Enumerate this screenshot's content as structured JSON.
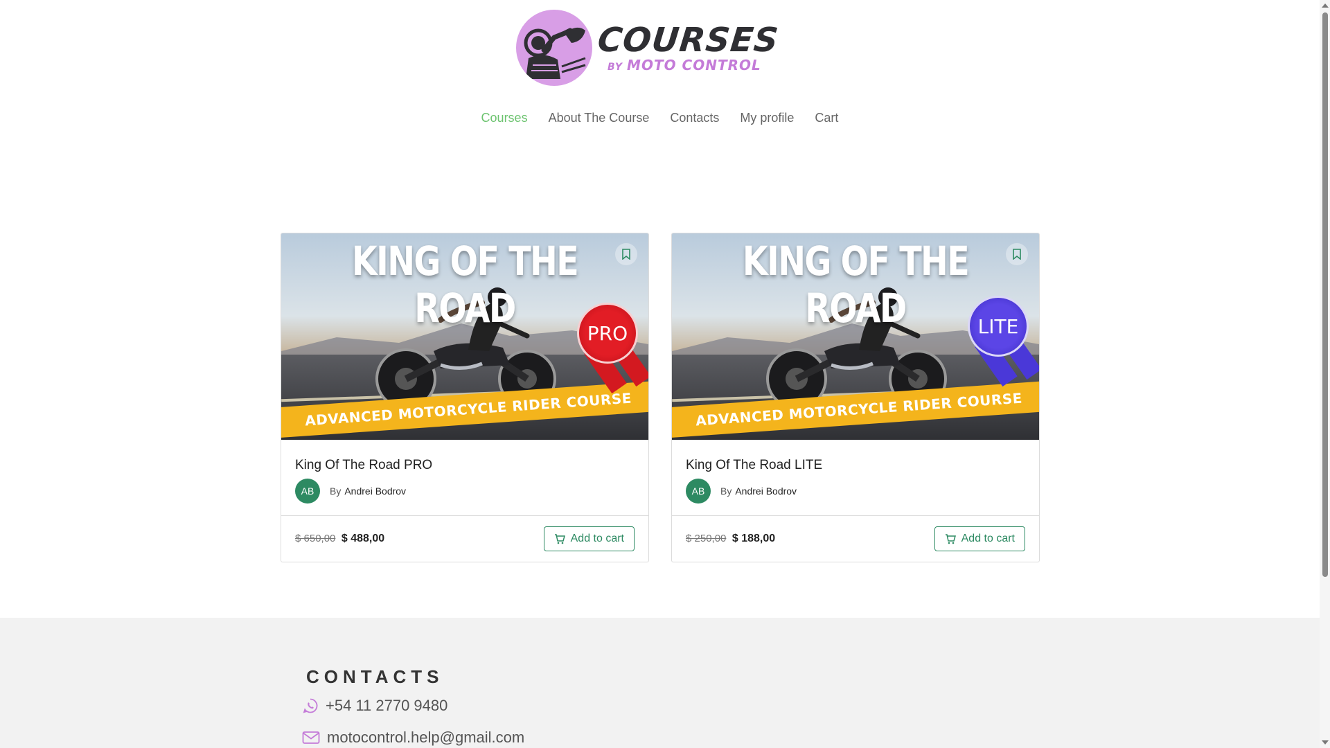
{
  "logo": {
    "main": "COURSES",
    "by": "BY",
    "sub": "MOTO CONTROL"
  },
  "nav": {
    "items": [
      {
        "label": "Courses",
        "active": true
      },
      {
        "label": "About The Course",
        "active": false
      },
      {
        "label": "Contacts",
        "active": false
      },
      {
        "label": "My profile",
        "active": false
      },
      {
        "label": "Cart",
        "active": false
      }
    ]
  },
  "courses": [
    {
      "image_title": "KING OF THE ROAD",
      "image_banner": "ADVANCED MOTORCYCLE RIDER COURSE",
      "badge": "PRO",
      "badge_color": "#e21d25",
      "title": "King Of The Road PRO",
      "author_initials": "AB",
      "by_label": "By",
      "author_name": "Andrei Bodrov",
      "old_price": "$ 650,00",
      "price": "$ 488,00",
      "cart_label": "Add to cart"
    },
    {
      "image_title": "KING OF THE ROAD",
      "image_banner": "ADVANCED MOTORCYCLE RIDER COURSE",
      "badge": "LITE",
      "badge_color": "#5b45e6",
      "title": "King Of The Road LITE",
      "author_initials": "AB",
      "by_label": "By",
      "author_name": "Andrei Bodrov",
      "old_price": "$ 250,00",
      "price": "$ 188,00",
      "cart_label": "Add to cart"
    }
  ],
  "footer": {
    "contacts_title": "CONTACTS",
    "phone": "+54 11 2770 9480",
    "email": "motocontrol.help@gmail.com"
  },
  "colors": {
    "accent_green": "#2d8a62",
    "nav_active": "#6cc36f",
    "logo_pink": "#d89ee6"
  }
}
